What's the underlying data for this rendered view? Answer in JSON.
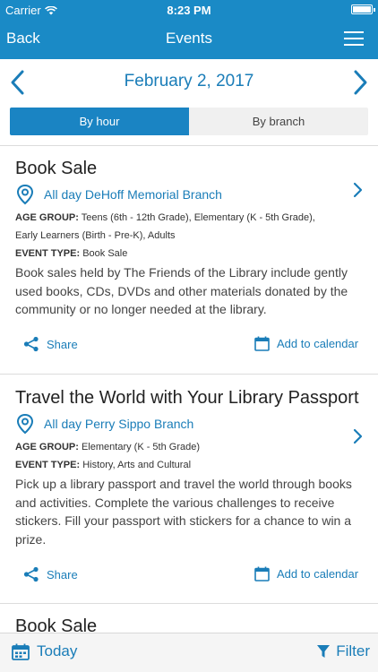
{
  "status_bar": {
    "carrier": "Carrier",
    "time": "8:23 PM"
  },
  "nav": {
    "back_label": "Back",
    "title": "Events"
  },
  "date_header": {
    "date": "February 2, 2017"
  },
  "segmented": {
    "by_hour": "By hour",
    "by_branch": "By branch",
    "selected": "By hour"
  },
  "labels": {
    "age_group": "AGE GROUP:",
    "event_type": "EVENT TYPE:",
    "share": "Share",
    "add_to_calendar": "Add to calendar"
  },
  "events": [
    {
      "title": "Book Sale",
      "time": "All day",
      "branch": "DeHoff Memorial Branch",
      "age_group_line1": "Teens (6th - 12th Grade), Elementary (K - 5th Grade),",
      "age_group_line2": "Early Learners (Birth - Pre-K), Adults",
      "event_type": "Book Sale",
      "description": "Book sales held by The Friends of the Library include gently used books, CDs, DVDs and other materials donated by the community or no longer needed at the library."
    },
    {
      "title": "Travel the World with Your Library Passport",
      "time": "All day",
      "branch": "Perry Sippo Branch",
      "age_group_line1": "Elementary (K - 5th Grade)",
      "event_type": "History, Arts and Cultural",
      "description": "Pick up a library passport and travel the world through books and activities. Complete the various challenges to receive stickers. Fill your passport with stickers for a chance to win a prize."
    },
    {
      "title": "Book Sale"
    }
  ],
  "toolbar": {
    "today_label": "Today",
    "filter_label": "Filter"
  },
  "colors": {
    "nav_blue": "#1a8ac6",
    "accent_blue": "#1a7db8",
    "segment_active": "#1a84c3"
  }
}
